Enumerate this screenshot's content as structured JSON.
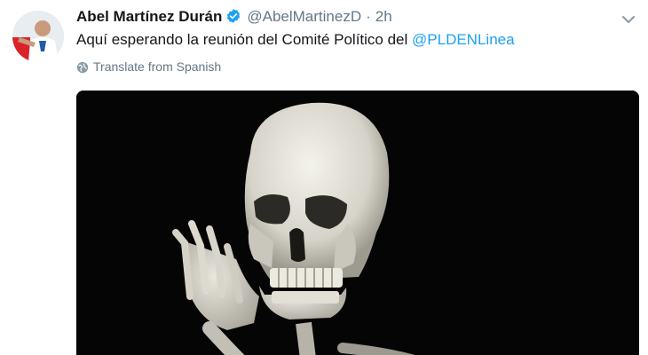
{
  "tweet": {
    "author_name": "Abel Martínez Durán",
    "handle": "@AbelMartinezD",
    "separator": "·",
    "time": "2h",
    "text": "Aquí esperando la reunión del Comité Político del ",
    "mention": "@PLDENLinea",
    "translate_label": "Translate from Spanish"
  },
  "icons": {
    "verified": "verified-badge-icon",
    "caret": "chevron-down-icon",
    "globe": "globe-icon"
  },
  "colors": {
    "link": "#1da1f2",
    "muted": "#657786",
    "text": "#14171a",
    "media_background": "#050505"
  }
}
